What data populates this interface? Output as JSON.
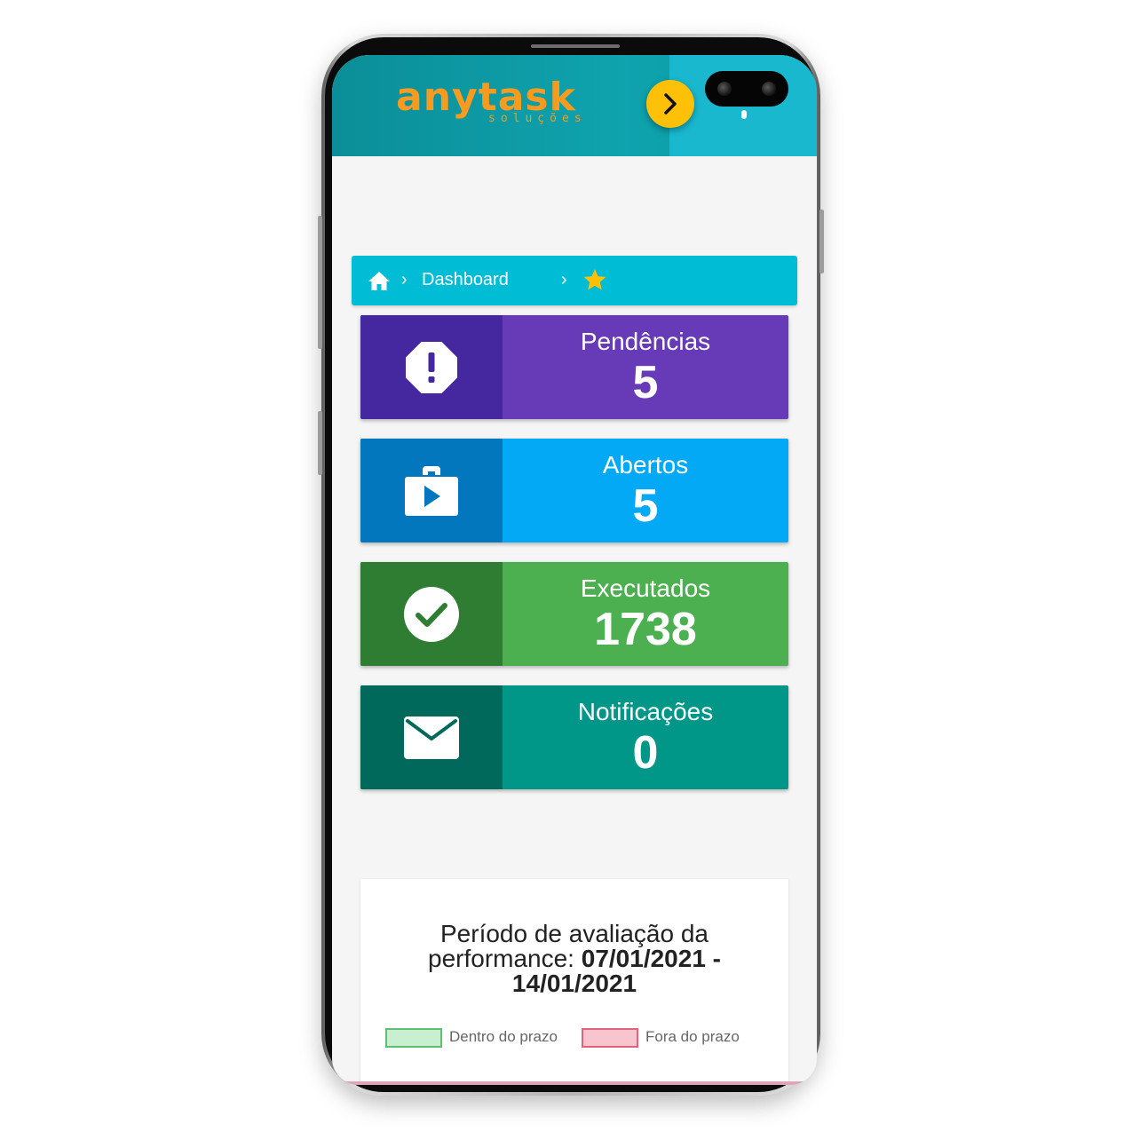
{
  "app": {
    "logo_text": "anytask",
    "logo_subtext": "soluções",
    "brand_color": "#f59b1f",
    "header_color": "#0b8e98"
  },
  "header": {
    "next_icon": "chevron-right-icon",
    "menu_icon": "kebab-menu-icon"
  },
  "breadcrumb": {
    "home_icon": "home-icon",
    "separator": "›",
    "current": "Dashboard",
    "favorite_icon": "star-icon"
  },
  "stats": [
    {
      "label": "Pendências",
      "value": "5",
      "icon": "alert-octagon-icon",
      "color": "#673ab7",
      "icon_bg": "#4527a0"
    },
    {
      "label": "Abertos",
      "value": "5",
      "icon": "briefcase-play-icon",
      "color": "#03a9f4",
      "icon_bg": "#0277bd"
    },
    {
      "label": "Executados",
      "value": "1738",
      "icon": "check-circle-icon",
      "color": "#4caf50",
      "icon_bg": "#2e7d32"
    },
    {
      "label": "Notificações",
      "value": "0",
      "icon": "mail-icon",
      "color": "#009688",
      "icon_bg": "#00695c"
    }
  ],
  "performance": {
    "title_prefix": "Período de avaliação da performance:",
    "period": "07/01/2021 - 14/01/2021",
    "legend": [
      {
        "label": "Dentro do prazo",
        "fill": "#c8efcf",
        "border": "#5cbf72"
      },
      {
        "label": "Fora do prazo",
        "fill": "#f8c5cf",
        "border": "#e3617b"
      }
    ]
  }
}
